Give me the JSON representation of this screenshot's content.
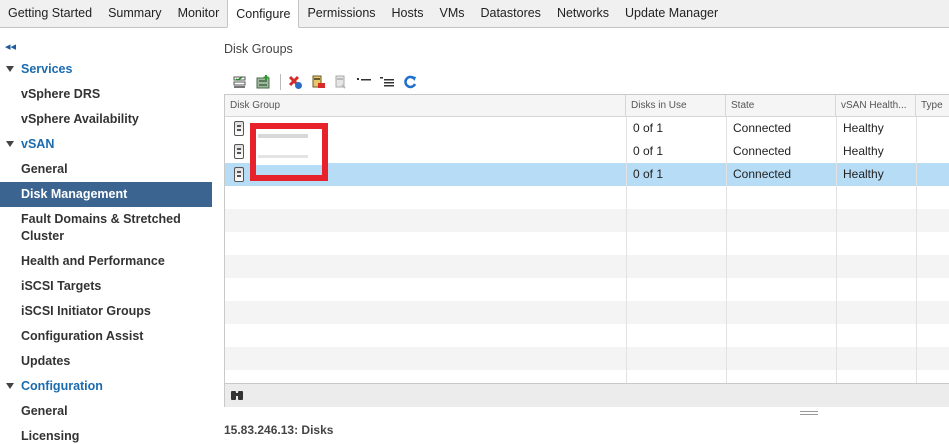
{
  "tabs": {
    "items": [
      {
        "label": "Getting Started"
      },
      {
        "label": "Summary"
      },
      {
        "label": "Monitor"
      },
      {
        "label": "Configure",
        "active": true
      },
      {
        "label": "Permissions"
      },
      {
        "label": "Hosts"
      },
      {
        "label": "VMs"
      },
      {
        "label": "Datastores"
      },
      {
        "label": "Networks"
      },
      {
        "label": "Update Manager"
      }
    ]
  },
  "sidebar": {
    "collapse_glyph": "◂◂",
    "groups": [
      {
        "label": "Services",
        "items": [
          "vSphere DRS",
          "vSphere Availability"
        ]
      },
      {
        "label": "vSAN",
        "items": [
          "General",
          "Disk Management",
          "Fault Domains & Stretched Cluster",
          "Health and Performance",
          "iSCSI Targets",
          "iSCSI Initiator Groups",
          "Configuration Assist",
          "Updates"
        ]
      },
      {
        "label": "Configuration",
        "items": [
          "General",
          "Licensing"
        ]
      }
    ],
    "active_item": "Disk Management"
  },
  "panel": {
    "title": "Disk Groups",
    "toolbar_icons": [
      "claim-disks-icon",
      "create-disk-group-icon",
      "remove-disk-group-icon",
      "add-disk-icon",
      "remove-disk-icon",
      "turn-on-led-icon",
      "turn-off-led-icon",
      "refresh-icon"
    ],
    "columns": [
      "Disk Group",
      "Disks in Use",
      "State",
      "vSAN Health...",
      "Type"
    ],
    "rows": [
      {
        "disks_in_use": "0 of 1",
        "state": "Connected",
        "health": "Healthy"
      },
      {
        "disks_in_use": "0 of 1",
        "state": "Connected",
        "health": "Healthy"
      },
      {
        "disks_in_use": "0 of 1",
        "state": "Connected",
        "health": "Healthy",
        "selected": true
      }
    ]
  },
  "details": {
    "title": "15.83.246.13: Disks"
  },
  "colors": {
    "accent": "#3b6590",
    "link": "#1a6bb0",
    "selection": "#b7dcf6",
    "redaction": "#e8222b"
  }
}
